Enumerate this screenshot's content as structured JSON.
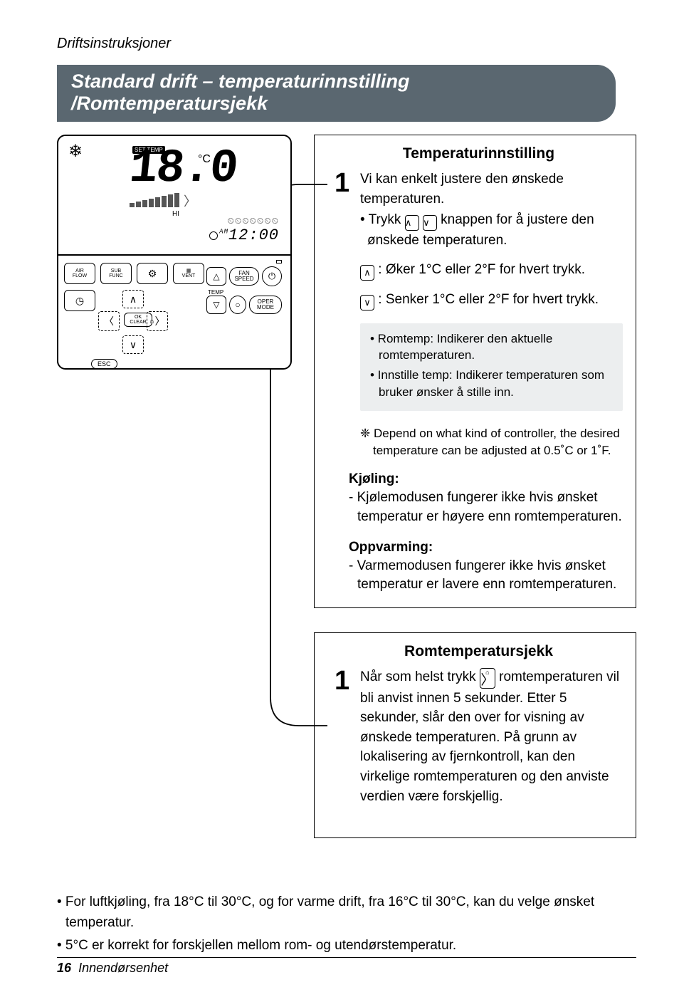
{
  "header": {
    "running_head": "Driftsinstruksjoner",
    "title": "Standard drift – temperaturinnstilling /Romtemperatursjekk"
  },
  "remote": {
    "set_temp_label": "SET TEMP",
    "temp_value": "18.0",
    "unit": "°C",
    "hi_label": "HI",
    "time": "12:00",
    "am": "AM",
    "buttons": {
      "air_flow": "AIR\nFLOW",
      "sub_func": "SUB\nFUNC",
      "vent": "VENT",
      "ok_clear": "OK\nCLEAR",
      "esc": "ESC",
      "fan_speed": "FAN\nSPEED",
      "temp": "TEMP",
      "oper_mode": "OPER\nMODE"
    }
  },
  "box1": {
    "title": "Temperaturinnstilling",
    "step1_a": "Vi kan enkelt justere den ønskede temperaturen.",
    "step1_b_pre": "• Trykk ",
    "step1_b_post": " knappen for å justere den ønskede temperaturen.",
    "up_desc": ": Øker 1°C eller 2°F for hvert trykk.",
    "down_desc": ": Senker 1°C eller 2°F for hvert trykk.",
    "note1": "• Romtemp: Indikerer den aktuelle romtemperaturen.",
    "note2": "• Innstille temp: Indikerer temperaturen som bruker ønsker å stille inn.",
    "small_note": "❈ Depend on what kind of controller, the desired temperature can be adjusted at 0.5˚C or 1˚F.",
    "kj_head": "Kjøling:",
    "kj_body": "- Kjølemodusen fungerer ikke hvis ønsket temperatur er høyere enn romtemperaturen.",
    "op_head": "Oppvarming:",
    "op_body": "- Varmemodusen fungerer ikke hvis ønsket temperatur er lavere enn romtemperaturen."
  },
  "box2": {
    "title": "Romtemperatursjekk",
    "step1_pre": "Når som helst trykk ",
    "step1_post": " romtemperaturen vil bli anvist innen 5 sekunder. Etter 5 sekunder, slår den over for visning av ønskede temperaturen. På grunn av lokalisering av fjernkontroll, kan den virkelige romtemperaturen og den anviste verdien være forskjellig."
  },
  "footer_bullets": {
    "b1": "• For luftkjøling, fra 18°C til 30°C, og for varme drift, fra 16°C til 30°C, kan du velge ønsket temperatur.",
    "b2": "• 5°C er korrekt for forskjellen mellom rom- og utendørstemperatur."
  },
  "page_footer": {
    "num": "16",
    "section": "Innendørsenhet"
  }
}
